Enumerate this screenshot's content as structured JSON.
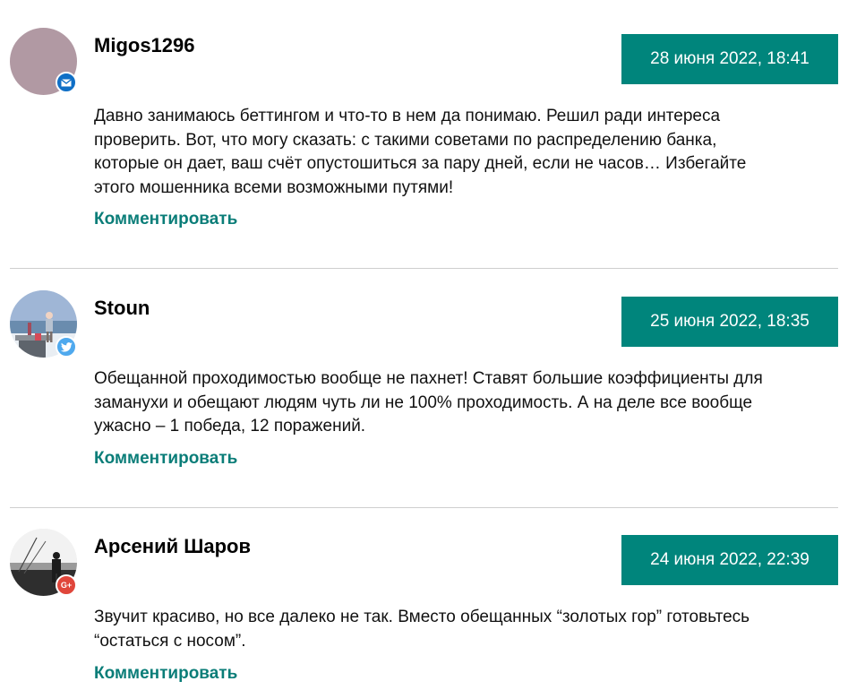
{
  "colors": {
    "accent": "#00857c",
    "date_bg": "#00857c",
    "link": "#0a7d78",
    "divider": "#cfcfcf",
    "mail_badge": "#0f6fc6",
    "twitter_badge": "#4fa9ee",
    "google_badge": "#e0463b"
  },
  "comments": [
    {
      "author": "Migos1296",
      "date": "28 июня 2022, 18:41",
      "text": "Давно занимаюсь беттингом и что-то в нем да понимаю. Решил ради интереса проверить. Вот, что могу сказать: с такими советами по распределению банка, которые он дает, ваш счёт опустошиться за пару дней, если не часов… Избегайте этого мошенника всеми возможными путями!",
      "reply_label": "Комментировать",
      "badge_icon": "mail-icon"
    },
    {
      "author": "Stoun",
      "date": "25 июня 2022, 18:35",
      "text": "Обещанной проходимостью вообще не пахнет! Ставят большие коэффициенты для заманухи и обещают людям чуть ли не 100% проходимость. А на деле все вообще ужасно – 1 победа, 12 поражений.",
      "reply_label": "Комментировать",
      "badge_icon": "twitter-icon"
    },
    {
      "author": "Арсений Шаров",
      "date": "24 июня 2022, 22:39",
      "text": "Звучит красиво, но все далеко не так. Вместо обещанных “золотых гор” готовьтесь “остаться с носом”.",
      "reply_label": "Комментировать",
      "badge_icon": "google-plus-icon",
      "badge_text": "G+"
    }
  ]
}
